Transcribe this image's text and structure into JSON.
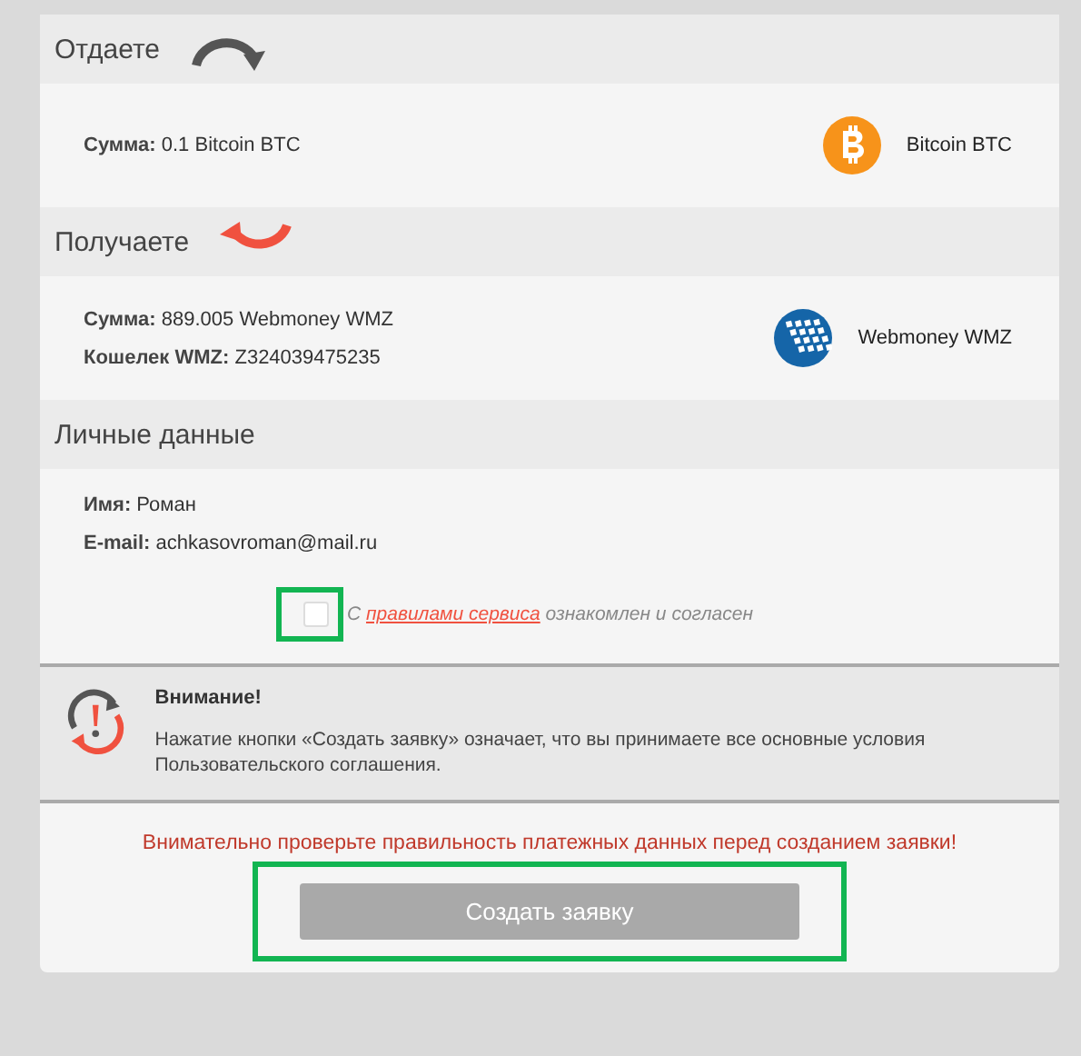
{
  "sections": [
    {
      "title": "Отдаете",
      "arrow": {
        "kind": "over"
      },
      "lines": [
        "**Сумма:** 0.1 Bitcoin BTC"
      ],
      "currency": {
        "name": "Bitcoin BTC",
        "kind": "bitcoin"
      }
    },
    {
      "title": "Получаете",
      "arrow": {
        "kind": "under"
      },
      "lines": [
        "**Сумма:** 889.005 Webmoney WMZ",
        "**Кошелек WMZ:** Z324039475235"
      ],
      "currency": {
        "name": "Webmoney WMZ",
        "kind": "webmoney"
      }
    },
    {
      "title": "Личные данные",
      "lines": [
        "**Имя:** Роман",
        "**E-mail:** achkasovroman@mail.ru"
      ]
    }
  ],
  "agreement": {
    "checked": false,
    "highlighted": true,
    "prefix": "С",
    "link": "правилами сервиса",
    "suffix": "ознакомлен и согласен"
  },
  "notice": {
    "title": "Внимание!",
    "text": "Нажатие кнопки «Создать заявку» означает, что вы принимаете все основные условия Пользовательского соглашения."
  },
  "warning": "Внимательно проверьте правильность платежных данных перед созданием заявки!",
  "submit": {
    "label": "Создать заявку",
    "disabled": true,
    "highlighted": true
  }
}
